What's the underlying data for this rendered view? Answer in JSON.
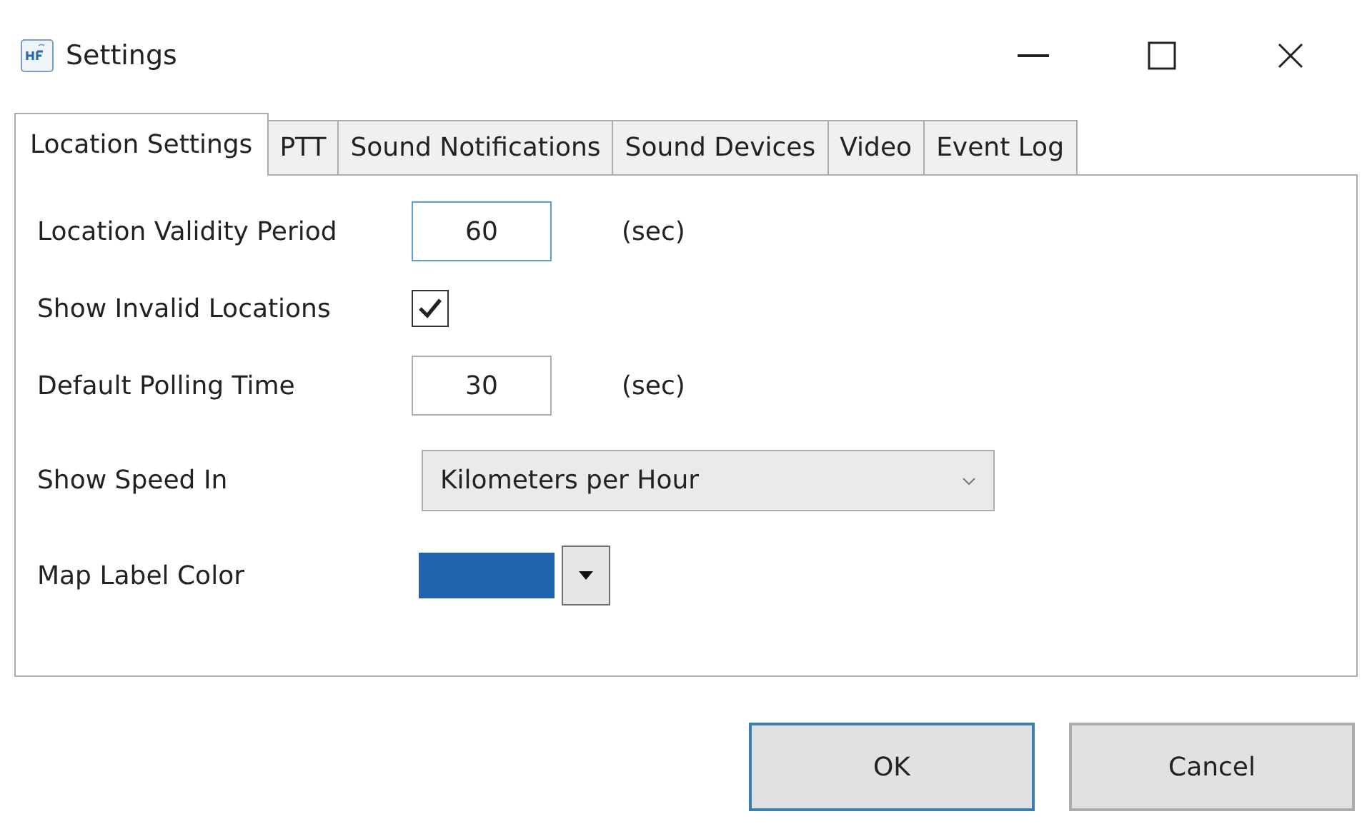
{
  "window": {
    "title": "Settings"
  },
  "tabs": [
    {
      "label": "Location Settings",
      "selected": true
    },
    {
      "label": "PTT",
      "selected": false
    },
    {
      "label": "Sound Notifications",
      "selected": false
    },
    {
      "label": "Sound Devices",
      "selected": false
    },
    {
      "label": "Video",
      "selected": false
    },
    {
      "label": "Event Log",
      "selected": false
    }
  ],
  "settings": [
    {
      "kind": "number",
      "label": "Location Validity Period",
      "value": "60",
      "unit": "(sec)",
      "focused": true
    },
    {
      "kind": "checkbox",
      "label": "Show Invalid Locations",
      "checked": true
    },
    {
      "kind": "number",
      "label": "Default Polling Time",
      "value": "30",
      "unit": "(sec)",
      "focused": false
    },
    {
      "kind": "select",
      "label": "Show Speed In",
      "value": "Kilometers per Hour"
    },
    {
      "kind": "color",
      "label": "Map Label Color",
      "color": "#1f64ac"
    }
  ],
  "buttons": [
    {
      "label": "OK",
      "default": true
    },
    {
      "label": "Cancel",
      "default": false
    }
  ]
}
